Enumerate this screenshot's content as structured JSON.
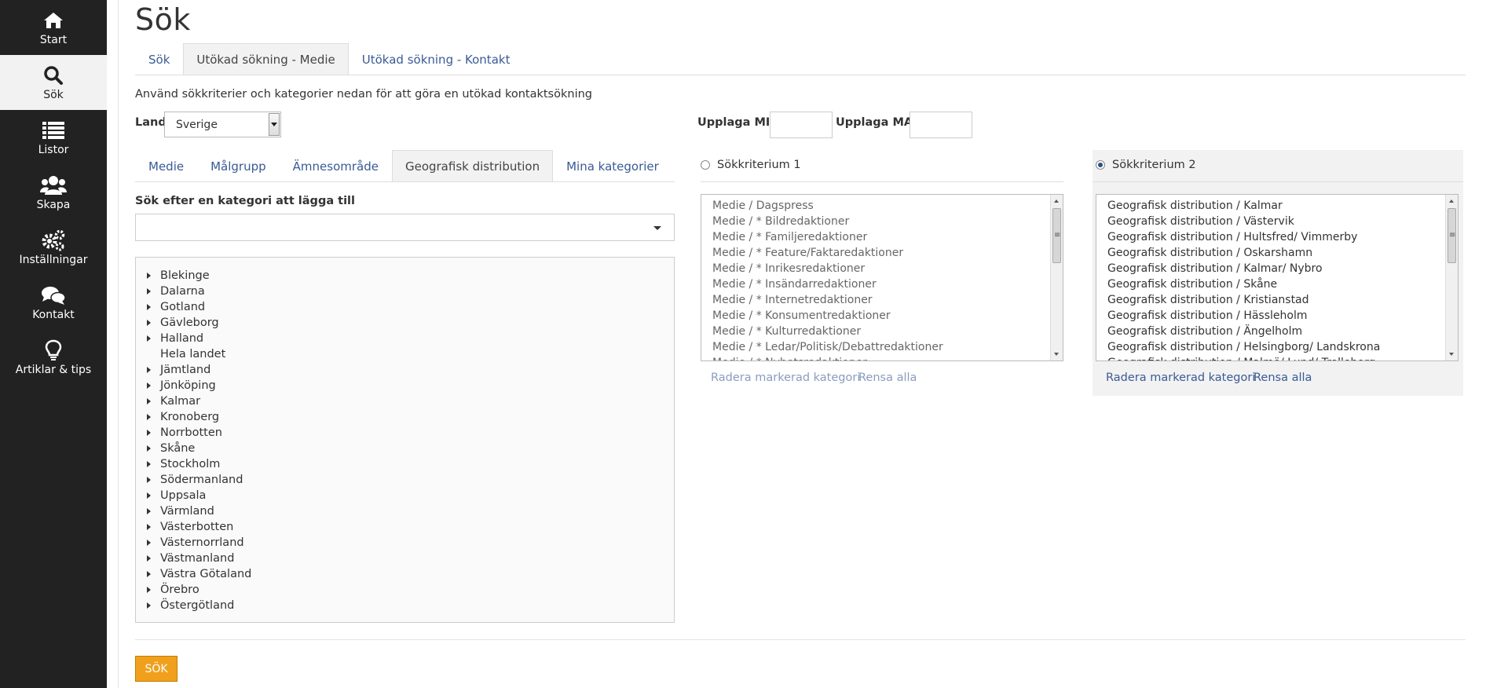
{
  "sidebar": {
    "items": [
      {
        "label": "Start",
        "icon": "home-icon"
      },
      {
        "label": "Sök",
        "icon": "search-icon"
      },
      {
        "label": "Listor",
        "icon": "list-icon"
      },
      {
        "label": "Skapa",
        "icon": "users-icon"
      },
      {
        "label": "Inställningar",
        "icon": "gears-icon"
      },
      {
        "label": "Kontakt",
        "icon": "chat-icon"
      },
      {
        "label": "Artiklar & tips",
        "icon": "lightbulb-icon"
      }
    ]
  },
  "page": {
    "title": "Sök",
    "tabs": [
      "Sök",
      "Utökad sökning - Medie",
      "Utökad sökning - Kontakt"
    ],
    "description": "Använd sökkriterier och kategorier nedan för att göra en utökad kontaktsökning"
  },
  "country": {
    "label": "Land",
    "value": "Sverige"
  },
  "circulation": {
    "min_label": "Upplaga MIN",
    "max_label": "Upplaga MAX",
    "min_value": "",
    "max_value": ""
  },
  "category_tabs": [
    "Medie",
    "Målgrupp",
    "Ämnesområde",
    "Geografisk distribution",
    "Mina kategorier"
  ],
  "category_search": {
    "label": "Sök efter en kategori att lägga till",
    "value": ""
  },
  "tree_items": [
    {
      "label": "Blekinge",
      "expandable": true
    },
    {
      "label": "Dalarna",
      "expandable": true
    },
    {
      "label": "Gotland",
      "expandable": true
    },
    {
      "label": "Gävleborg",
      "expandable": true
    },
    {
      "label": "Halland",
      "expandable": true
    },
    {
      "label": "Hela landet",
      "expandable": false
    },
    {
      "label": "Jämtland",
      "expandable": true
    },
    {
      "label": "Jönköping",
      "expandable": true
    },
    {
      "label": "Kalmar",
      "expandable": true
    },
    {
      "label": "Kronoberg",
      "expandable": true
    },
    {
      "label": "Norrbotten",
      "expandable": true
    },
    {
      "label": "Skåne",
      "expandable": true
    },
    {
      "label": "Stockholm",
      "expandable": true
    },
    {
      "label": "Södermanland",
      "expandable": true
    },
    {
      "label": "Uppsala",
      "expandable": true
    },
    {
      "label": "Värmland",
      "expandable": true
    },
    {
      "label": "Västerbotten",
      "expandable": true
    },
    {
      "label": "Västernorrland",
      "expandable": true
    },
    {
      "label": "Västmanland",
      "expandable": true
    },
    {
      "label": "Västra Götaland",
      "expandable": true
    },
    {
      "label": "Örebro",
      "expandable": true
    },
    {
      "label": "Östergötland",
      "expandable": true
    }
  ],
  "criteria": [
    {
      "title": "Sökkriterium 1",
      "selected": false,
      "items": [
        "Medie / Dagspress",
        "Medie / * Bildredaktioner",
        "Medie / * Familjeredaktioner",
        "Medie / * Feature/Faktaredaktioner",
        "Medie / * Inrikesredaktioner",
        "Medie / * Insändarredaktioner",
        "Medie / * Internetredaktioner",
        "Medie / * Konsumentredaktioner",
        "Medie / * Kulturredaktioner",
        "Medie / * Ledar/Politisk/Debattredaktioner",
        "Medie / * Nyhetsredaktioner"
      ],
      "delete_label": "Radera markerad kategori",
      "clear_label": "Rensa alla"
    },
    {
      "title": "Sökkriterium 2",
      "selected": true,
      "items": [
        "Geografisk distribution / Kalmar",
        "Geografisk distribution / Västervik",
        "Geografisk distribution / Hultsfred/ Vimmerby",
        "Geografisk distribution / Oskarshamn",
        "Geografisk distribution / Kalmar/ Nybro",
        "Geografisk distribution / Skåne",
        "Geografisk distribution / Kristianstad",
        "Geografisk distribution / Hässleholm",
        "Geografisk distribution / Ängelholm",
        "Geografisk distribution / Helsingborg/ Landskrona",
        "Geografisk distribution / Malmö/ Lund/ Trelleborg"
      ],
      "delete_label": "Radera markerad kategori",
      "clear_label": "Rensa alla"
    }
  ],
  "submit_label": "SÖK",
  "colors": {
    "sidebar": "#222222",
    "accent": "#f0a01c",
    "link": "#3a5a95"
  }
}
